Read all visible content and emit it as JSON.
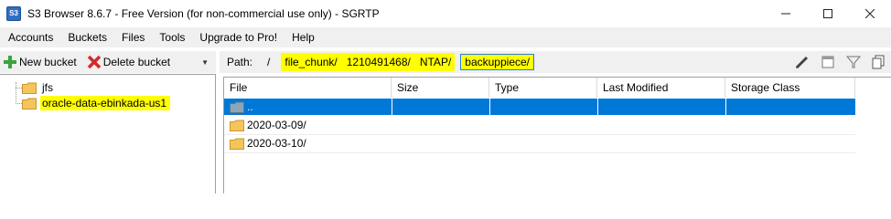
{
  "window": {
    "title": "S3 Browser 8.6.7 - Free Version (for non-commercial use only) - SGRTP",
    "app_icon_text": "S3",
    "controls": {
      "minimize": "—",
      "maximize": "☐",
      "close": "✕"
    }
  },
  "menu": {
    "items": [
      "Accounts",
      "Buckets",
      "Files",
      "Tools",
      "Upgrade to Pro!",
      "Help"
    ]
  },
  "toolbar": {
    "new_bucket": "New bucket",
    "delete_bucket": "Delete bucket",
    "collapse_arrow": "▼"
  },
  "tree": {
    "items": [
      {
        "label": "jfs",
        "highlighted": false
      },
      {
        "label": "oracle-data-ebinkada-us1",
        "highlighted": true
      }
    ]
  },
  "path": {
    "label": "Path:",
    "root": "/",
    "segment_1": "file_chunk/",
    "segment_2": "1210491468/",
    "segment_3": "NTAP/",
    "segment_4": "backuppiece/"
  },
  "filelist": {
    "columns": [
      "File",
      "Size",
      "Type",
      "Last Modified",
      "Storage Class"
    ],
    "rows": [
      {
        "name": "..",
        "selected": true
      },
      {
        "name": "2020-03-09/",
        "selected": false
      },
      {
        "name": "2020-03-10/",
        "selected": false
      }
    ]
  },
  "colors": {
    "highlight": "#ffff00",
    "selection": "#0078d7",
    "folder": "#f4c55a"
  }
}
